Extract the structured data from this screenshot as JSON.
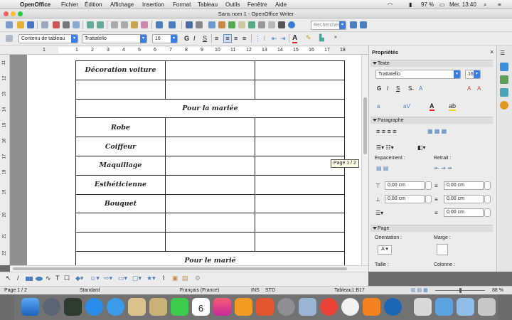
{
  "menubar": {
    "app": "OpenOffice",
    "items": [
      "Fichier",
      "Édition",
      "Affichage",
      "Insertion",
      "Format",
      "Tableau",
      "Outils",
      "Fenêtre",
      "Aide"
    ],
    "battery": "97 %",
    "clock": "Mer. 13:40"
  },
  "window": {
    "title": "Sans nom 1 - OpenOffice Writer"
  },
  "toolbar": {
    "search_placeholder": "Rechercher",
    "paragraph_style": "Contenu de tableau",
    "font_name": "Trattatello",
    "font_size": "16",
    "bold": "G",
    "italic": "I",
    "underline": "S"
  },
  "ruler": {
    "h_ticks": [
      "1",
      "1",
      "2",
      "3",
      "4",
      "5",
      "6",
      "7",
      "8",
      "9",
      "10",
      "11",
      "12",
      "13",
      "14",
      "15",
      "16",
      "17",
      "18"
    ],
    "v_ticks": [
      "11",
      "12",
      "13",
      "14",
      "15",
      "16",
      "17",
      "18",
      "19",
      "20",
      "21",
      "22"
    ]
  },
  "table": {
    "rows": [
      {
        "type": "item",
        "label": "Décoration voiture"
      },
      {
        "type": "item",
        "label": ""
      },
      {
        "type": "header",
        "label": "Pour la mariée"
      },
      {
        "type": "item",
        "label": "Robe"
      },
      {
        "type": "item",
        "label": "Coiffeur"
      },
      {
        "type": "item",
        "label": "Maquillage"
      },
      {
        "type": "item",
        "label": "Esthéticienne"
      },
      {
        "type": "item",
        "label": "Bouquet"
      },
      {
        "type": "item",
        "label": ""
      },
      {
        "type": "item",
        "label": ""
      },
      {
        "type": "header",
        "label": "Pour le marié"
      }
    ]
  },
  "tooltip": "Page 1 / 2",
  "sidebar": {
    "title": "Propriétés",
    "texte": {
      "header": "Texte",
      "font": "Trattatello",
      "size": "16",
      "bold": "G",
      "italic": "I",
      "underline": "S"
    },
    "paragraphe": {
      "header": "Paragraphe",
      "espacement_label": "Espacement :",
      "retrait_label": "Retrait :",
      "fields": [
        "0,00 cm",
        "0,00 cm",
        "0,00 cm",
        "0,00 cm",
        "0,00 cm"
      ]
    },
    "page": {
      "header": "Page",
      "orientation_label": "Orientation :",
      "marge_label": "Marge :",
      "taille_label": "Taille :",
      "colonne_label": "Colonne :"
    }
  },
  "status": {
    "page": "Page 1 / 2",
    "style": "Standard",
    "language": "Français (France)",
    "insert": "INS",
    "selection": "STD",
    "cell": "Tableau1:B17",
    "zoom": "88 %"
  },
  "dock": {
    "calendar_date": "6"
  }
}
